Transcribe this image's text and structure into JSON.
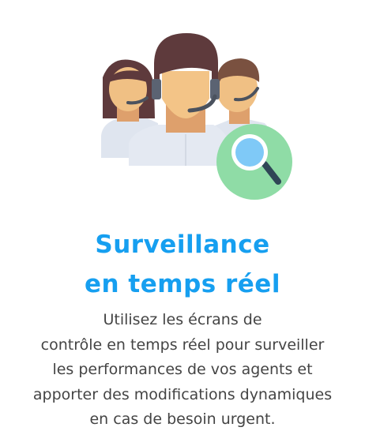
{
  "illustration": {
    "icon": "call-center-agents-with-magnifier-icon"
  },
  "title": {
    "line1": "Surveillance",
    "line2": "en temps réel"
  },
  "description": {
    "lines": [
      "Utilisez les écrans de",
      "contrôle en temps réel pour surveiller",
      "les performances de vos agents et",
      "apporter des modifications dynamiques",
      "en cas de besoin urgent."
    ]
  },
  "colors": {
    "title": "#169ff0",
    "text": "#444444",
    "badge": "#8fdca6"
  }
}
